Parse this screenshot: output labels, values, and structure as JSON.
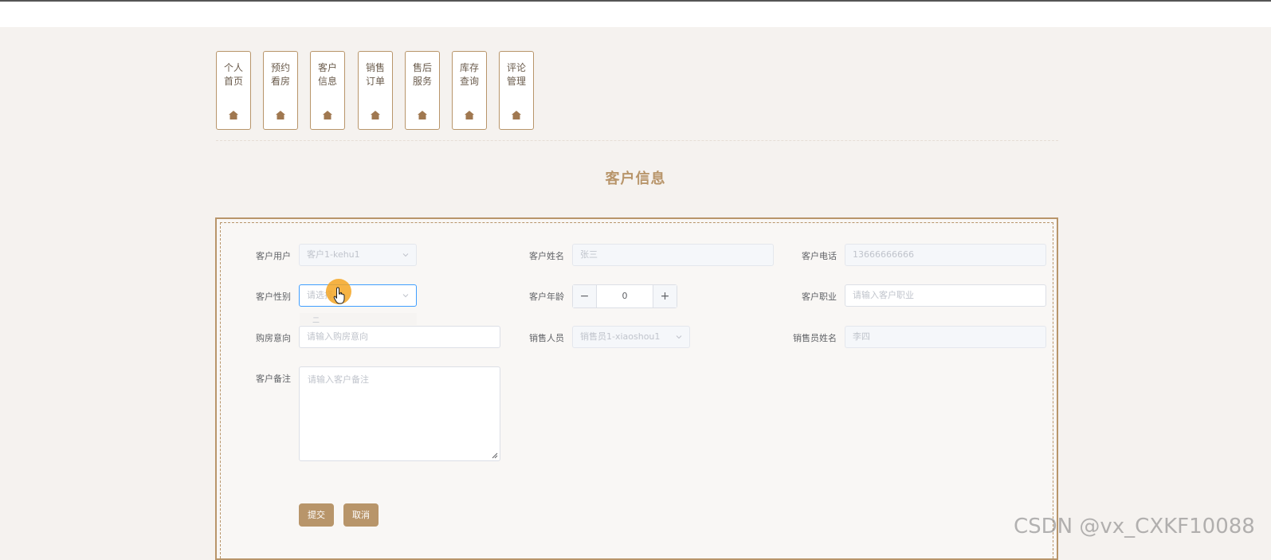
{
  "nav": {
    "items": [
      {
        "label": "个人首页",
        "icon": "house-icon"
      },
      {
        "label": "预约看房",
        "icon": "house-icon"
      },
      {
        "label": "客户信息",
        "icon": "house-icon"
      },
      {
        "label": "销售订单",
        "icon": "house-icon"
      },
      {
        "label": "售后服务",
        "icon": "house-icon"
      },
      {
        "label": "库存查询",
        "icon": "house-icon"
      },
      {
        "label": "评论管理",
        "icon": "house-icon"
      }
    ]
  },
  "page_title": "客户信息",
  "form": {
    "customer_user": {
      "label": "客户用户",
      "value": "客户1-kehu1"
    },
    "customer_name": {
      "label": "客户姓名",
      "value": "张三"
    },
    "customer_phone": {
      "label": "客户电话",
      "value": "13666666666"
    },
    "customer_gender": {
      "label": "客户性别",
      "placeholder": "请选择"
    },
    "customer_age": {
      "label": "客户年龄",
      "value": "0",
      "minus": "−",
      "plus": "+"
    },
    "customer_job": {
      "label": "客户职业",
      "placeholder": "请输入客户职业"
    },
    "purchase_intent": {
      "label": "购房意向",
      "placeholder": "请输入购房意向"
    },
    "sales_person": {
      "label": "销售人员",
      "value": "销售员1-xiaoshou1"
    },
    "sales_person_name": {
      "label": "销售员姓名",
      "value": "李四"
    },
    "customer_notes": {
      "label": "客户备注",
      "placeholder": "请输入客户备注"
    },
    "gender_option": "二",
    "submit_label": "提交",
    "cancel_label": "取消"
  },
  "watermark": "CSDN @vx_CXKF10088",
  "colors": {
    "accent": "#b8956a",
    "focus": "#409eff"
  }
}
